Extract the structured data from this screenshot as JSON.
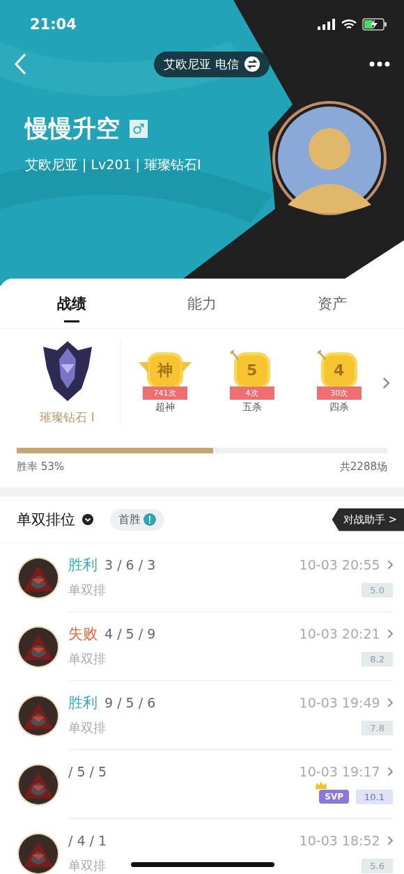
{
  "status_bar": {
    "time": "21:04"
  },
  "header": {
    "server": "艾欧尼亚 电信",
    "name": "慢慢升空",
    "gender": "♂",
    "subtitle": "艾欧尼亚 | Lv201 | 璀璨钻石I"
  },
  "tabs": [
    {
      "label": "战绩",
      "selected": true
    },
    {
      "label": "能力",
      "selected": false
    },
    {
      "label": "资产",
      "selected": false
    }
  ],
  "rank": {
    "label": "璀璨钻石 I"
  },
  "achievements": [
    {
      "kind": "winged",
      "symbol": "神",
      "count": "741次",
      "label": "超神"
    },
    {
      "kind": "sword",
      "symbol": "5",
      "count": "4次",
      "label": "五杀"
    },
    {
      "kind": "sword",
      "symbol": "4",
      "count": "30次",
      "label": "四杀"
    }
  ],
  "win_rate": {
    "level": 0.53,
    "text": "胜率 53%",
    "total": "共2288场"
  },
  "section": {
    "title": "单双排位",
    "chip": "首胜",
    "assistant": "对战助手 >"
  },
  "matches": [
    {
      "kind": "win",
      "result": "胜利",
      "kda": "3 / 6 / 3",
      "mode": "单双排",
      "time": "10-03 20:55",
      "score": "5.0"
    },
    {
      "kind": "loss",
      "result": "失败",
      "kda": "4 / 5 / 9",
      "mode": "单双排",
      "time": "10-03 20:21",
      "score": "8.2"
    },
    {
      "kind": "win",
      "result": "胜利",
      "kda": "9 / 5 / 6",
      "mode": "单双排",
      "time": "10-03 19:49",
      "score": "7.8"
    },
    {
      "kda": "/ 5 / 5",
      "time": "10-03 19:17",
      "badge": "SVP",
      "score": "10.1"
    },
    {
      "kda": "/ 4 / 1",
      "mode": "单双排",
      "time": "10-03 18:52",
      "score": "5.6"
    }
  ]
}
